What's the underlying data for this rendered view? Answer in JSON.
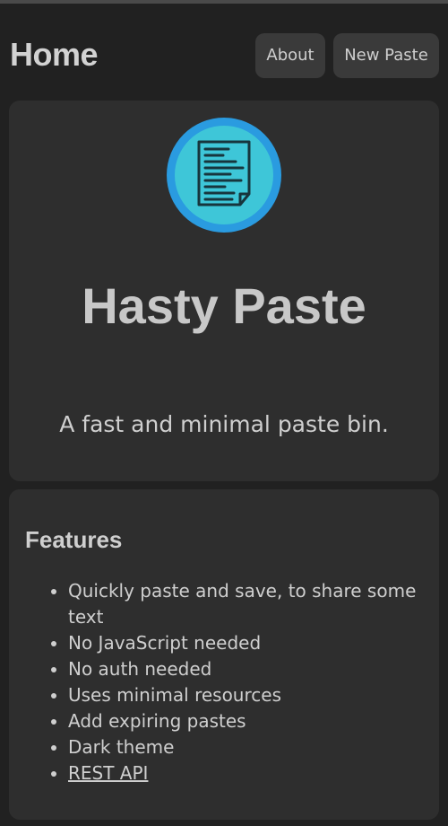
{
  "header": {
    "title": "Home",
    "nav": {
      "about_label": "About",
      "new_paste_label": "New Paste"
    }
  },
  "hero": {
    "logo_icon": "document-icon",
    "title": "Hasty Paste",
    "tagline": "A fast and minimal paste bin."
  },
  "features": {
    "heading": "Features",
    "items": [
      "Quickly paste and save, to share some text",
      "No JavaScript needed",
      "No auth needed",
      "Uses minimal resources",
      "Add expiring pastes",
      "Dark theme"
    ],
    "link_item": "REST API"
  },
  "colors": {
    "background": "#212121",
    "card": "#2e2e2e",
    "button": "#3a3a3a",
    "logo_ring": "#2a9be0",
    "logo_fill": "#3ec6d8"
  }
}
